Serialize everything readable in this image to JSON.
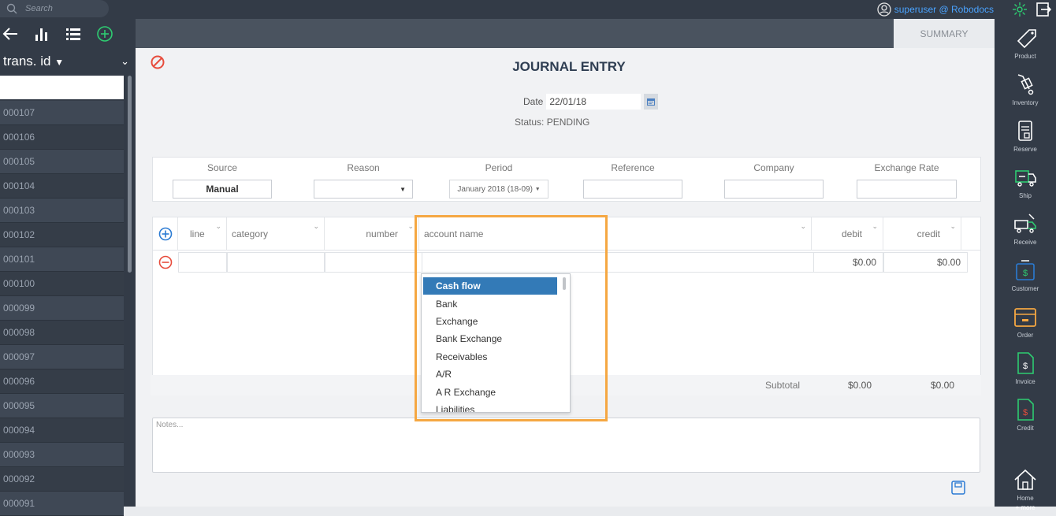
{
  "topbar": {
    "search_placeholder": "Search",
    "user": "superuser @ Robodocs"
  },
  "left": {
    "filter_label": "trans. id",
    "ids": [
      "000107",
      "000106",
      "000105",
      "000104",
      "000103",
      "000102",
      "000101",
      "000100",
      "000099",
      "000098",
      "000097",
      "000096",
      "000095",
      "000094",
      "000093",
      "000092",
      "000091"
    ]
  },
  "tab": {
    "summary": "SUMMARY"
  },
  "entry": {
    "title": "JOURNAL ENTRY",
    "date_label": "Date",
    "date_value": "22/01/18",
    "status": "Status: PENDING",
    "fields": {
      "source_label": "Source",
      "source_value": "Manual",
      "reason_label": "Reason",
      "reason_value": "",
      "period_label": "Period",
      "period_value": "January 2018 (18-09)",
      "reference_label": "Reference",
      "company_label": "Company",
      "exchange_label": "Exchange Rate"
    }
  },
  "grid": {
    "headers": {
      "line": "line",
      "category": "category",
      "number": "number",
      "account": "account name",
      "debit": "debit",
      "credit": "credit"
    },
    "row": {
      "debit": "$0.00",
      "credit": "$0.00"
    },
    "subtotal_label": "Subtotal",
    "subtotal_debit": "$0.00",
    "subtotal_credit": "$0.00"
  },
  "dropdown": {
    "options": [
      "Cash flow",
      "Bank",
      "Exchange",
      "Bank Exchange",
      "Receivables",
      "A/R",
      "A R Exchange",
      "Liabilities"
    ],
    "selected": "Cash flow"
  },
  "notes_placeholder": "Notes...",
  "nav": {
    "items": [
      "Product",
      "Inventory",
      "Reserve",
      "Ship",
      "Receive",
      "Customer",
      "Order",
      "Invoice",
      "Credit",
      "Home"
    ],
    "more": "+ more"
  },
  "colors": {
    "accent_blue": "#337ab7",
    "highlight": "#f5a742",
    "sidebar": "#333b47",
    "green": "#2ecc71"
  }
}
